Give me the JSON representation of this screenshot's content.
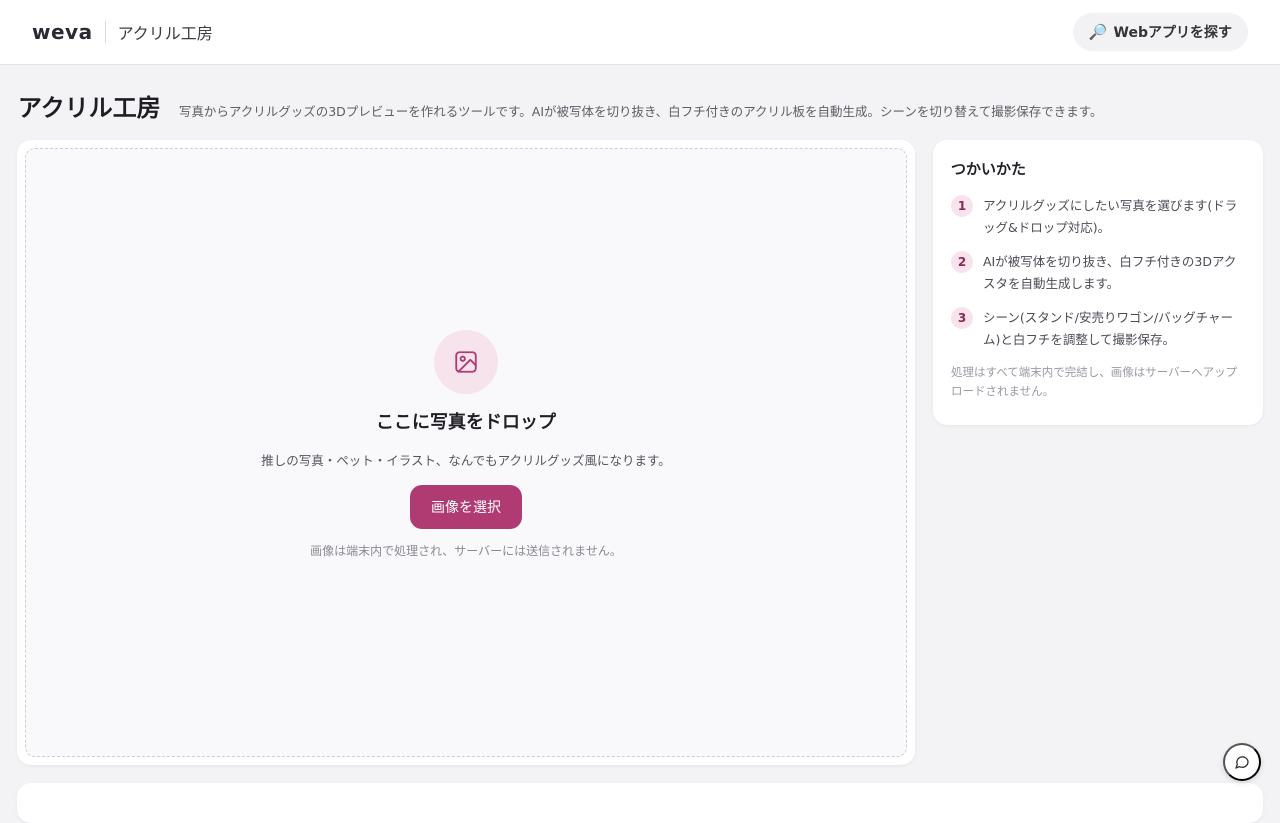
{
  "header": {
    "logo": "weva",
    "app_name": "アクリル工房",
    "explore_icon": "magnifier-icon",
    "explore_label": "Webアプリを探す"
  },
  "page": {
    "title": "アクリル工房",
    "description": "写真からアクリルグッズの3Dプレビューを作れるツールです。AIが被写体を切り抜き、白フチ付きのアクリル板を自動生成。シーンを切り替えて撮影保存できます。"
  },
  "dropzone": {
    "icon": "image-icon",
    "title": "ここに写真をドロップ",
    "subtitle": "推しの写真・ペット・イラスト、なんでもアクリルグッズ風になります。",
    "button_label": "画像を選択",
    "note": "画像は端末内で処理され、サーバーには送信されません。"
  },
  "howto": {
    "title": "つかいかた",
    "steps": [
      {
        "num": "1",
        "text": "アクリルグッズにしたい写真を選びます(ドラッグ&ドロップ対応)。"
      },
      {
        "num": "2",
        "text": "AIが被写体を切り抜き、白フチ付きの3Dアクスタを自動生成します。"
      },
      {
        "num": "3",
        "text": "シーン(スタンド/安売りワゴン/バッグチャーム)と白フチを調整して撮影保存。"
      }
    ],
    "note": "処理はすべて端末内で完結し、画像はサーバーへアップロードされません。"
  },
  "chat": {
    "icon": "chat-bubble-icon"
  },
  "colors": {
    "accent": "#b03a72",
    "accent_soft": "#f6e3ec",
    "background": "#f3f3f5"
  }
}
